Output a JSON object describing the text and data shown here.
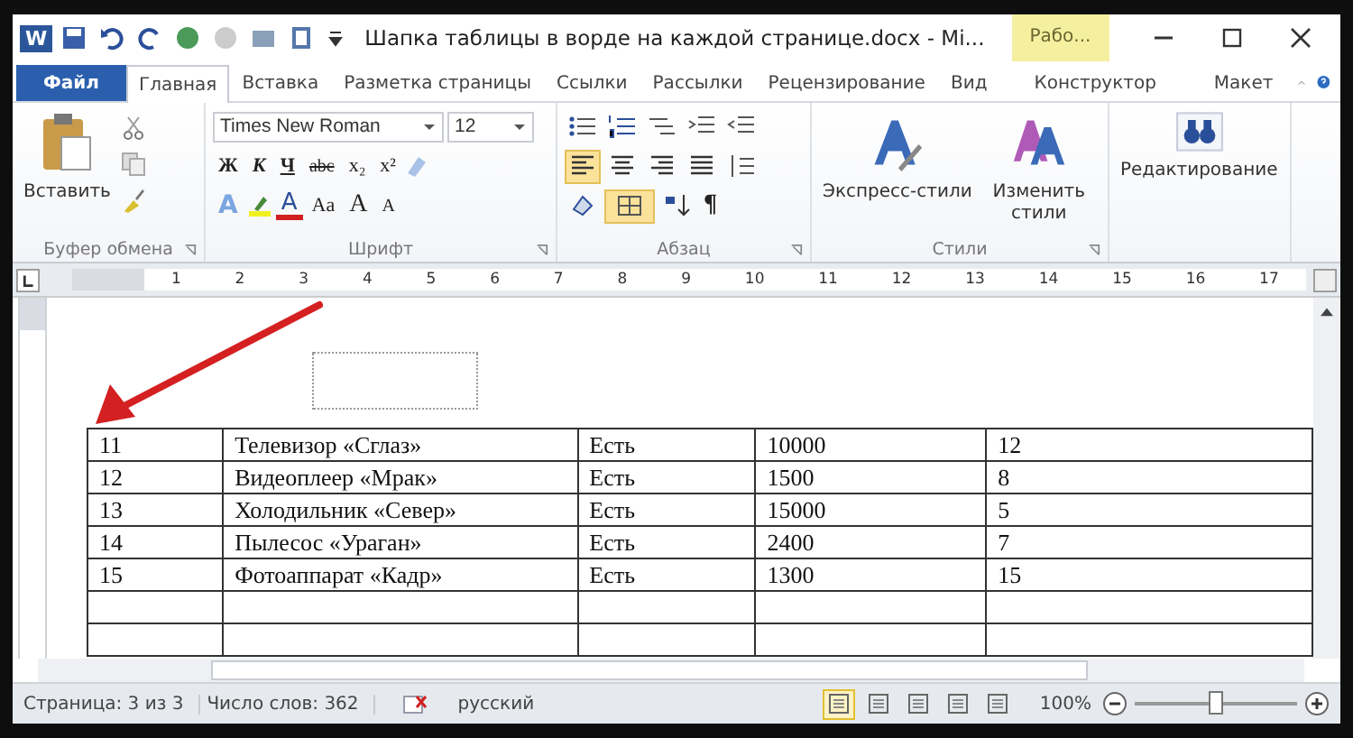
{
  "window": {
    "app_letter": "W",
    "title": "Шапка таблицы в ворде на каждой странице.docx - Mi...",
    "context_tab": "Рабо..."
  },
  "tabs": [
    {
      "label": "Файл",
      "kind": "file",
      "selected": false
    },
    {
      "label": "Главная",
      "kind": "tab",
      "selected": true
    },
    {
      "label": "Вставка",
      "kind": "tab",
      "selected": false
    },
    {
      "label": "Разметка страницы",
      "kind": "tab",
      "selected": false
    },
    {
      "label": "Ссылки",
      "kind": "tab",
      "selected": false
    },
    {
      "label": "Рассылки",
      "kind": "tab",
      "selected": false
    },
    {
      "label": "Рецензирование",
      "kind": "tab",
      "selected": false
    },
    {
      "label": "Вид",
      "kind": "tab",
      "selected": false
    },
    {
      "label": "Конструктор",
      "kind": "context",
      "selected": false
    },
    {
      "label": "Макет",
      "kind": "context",
      "selected": false
    }
  ],
  "ribbon": {
    "clipboard": {
      "paste": "Вставить",
      "label": "Буфер обмена"
    },
    "font": {
      "name": "Times New Roman",
      "size": "12",
      "buttons": [
        "Ж",
        "К",
        "Ч",
        "abc",
        "x₂",
        "x²"
      ],
      "effects": "A",
      "color_button": "A",
      "case": "Aa",
      "grow": "A",
      "shrink": "A",
      "label": "Шрифт"
    },
    "paragraph": {
      "align": [
        {
          "selected": true
        },
        {
          "selected": false
        },
        {
          "selected": false
        },
        {
          "selected": false
        }
      ],
      "borders_selected": true,
      "pilcrow": "¶",
      "label": "Абзац"
    },
    "styles": {
      "quick": "Экспресс-стили",
      "change": "Изменить стили",
      "label": "Стили"
    },
    "editing": {
      "label": "Редактирование"
    }
  },
  "ruler": [
    "1",
    "2",
    "3",
    "4",
    "5",
    "6",
    "7",
    "8",
    "9",
    "10",
    "11",
    "12",
    "13",
    "14",
    "15",
    "16",
    "17"
  ],
  "table": {
    "rows": [
      [
        "11",
        "Телевизор «Сглаз»",
        "Есть",
        "10000",
        "12"
      ],
      [
        "12",
        "Видеоплеер «Мрак»",
        "Есть",
        "1500",
        "8"
      ],
      [
        "13",
        "Холодильник «Север»",
        "Есть",
        "15000",
        "5"
      ],
      [
        "14",
        "Пылесос «Ураган»",
        "Есть",
        "2400",
        "7"
      ],
      [
        "15",
        "Фотоаппарат «Кадр»",
        "Есть",
        "1300",
        "15"
      ]
    ]
  },
  "status_bar": {
    "page": "Страница: 3 из 3",
    "words": "Число слов: 362",
    "language": "русский",
    "views": [
      {
        "selected": true
      },
      {
        "selected": false
      },
      {
        "selected": false
      },
      {
        "selected": false
      },
      {
        "selected": false
      }
    ],
    "zoom": "100%",
    "zoom_slider": {
      "level": 0.5
    }
  }
}
